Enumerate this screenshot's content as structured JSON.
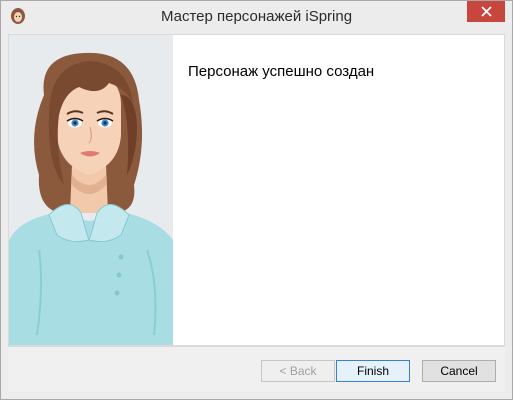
{
  "window": {
    "title": "Мастер персонажей iSpring",
    "app_icon": "character-avatar-icon",
    "close_icon": "close-icon"
  },
  "main": {
    "message": "Персонаж успешно создан",
    "illustration": "woman-character-illustration"
  },
  "footer": {
    "back_label": "< Back",
    "finish_label": "Finish",
    "cancel_label": "Cancel"
  },
  "colors": {
    "close_button": "#c7463e",
    "finish_border": "#3c7fd0",
    "left_panel_bg": "#e7ebee",
    "shirt": "#a8dde3",
    "hair": "#8b5a3c"
  }
}
